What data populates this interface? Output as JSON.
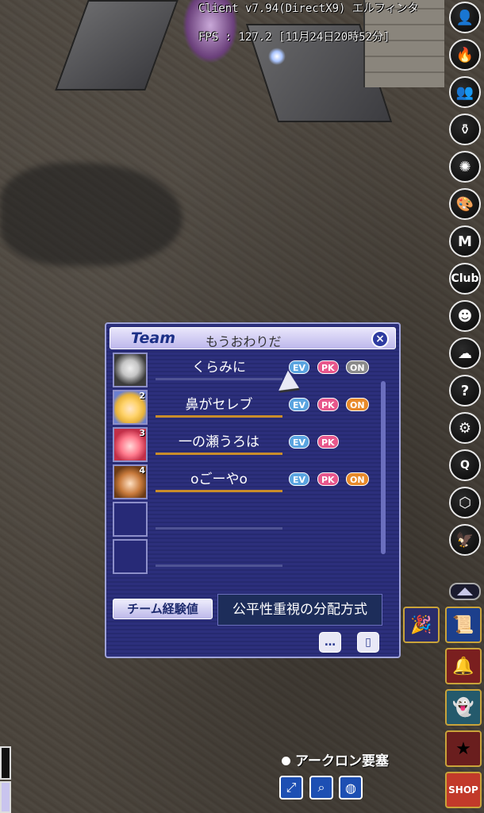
{
  "system": {
    "client_line": "Client v7.94(DirectX9) エルフィンタ",
    "fps_line": "FPS : 127.2 [11月24日20時52分]"
  },
  "team": {
    "header_label": "Team",
    "team_name": "もうおわりだ",
    "close_icon": "×",
    "members": [
      {
        "name": "くらみに",
        "number": "",
        "tags": [
          "EV",
          "PK",
          "ON"
        ]
      },
      {
        "name": "鼻がセレブ",
        "number": "2",
        "tags": [
          "EV",
          "PK",
          "ON"
        ]
      },
      {
        "name": "一の瀬うろは",
        "number": "3",
        "tags": [
          "EV",
          "PK"
        ]
      },
      {
        "name": "oごーやo",
        "number": "4",
        "tags": [
          "EV",
          "PK",
          "ON"
        ]
      }
    ],
    "exp_button": "チーム経験値",
    "distribution_mode": "公平性重視の分配方式",
    "chat_icon": "…",
    "exit_icon": "▯"
  },
  "toolbar": {
    "icons": [
      "person-icon",
      "fire-c-icon",
      "party-icon",
      "bottle-icon",
      "skill-icon",
      "palette-icon",
      "guild-icon",
      "club-icon",
      "friend-icon",
      "ghost-icon",
      "quest-icon",
      "gear-icon",
      "q-icon",
      "hexagon-icon",
      "eagle-icon"
    ],
    "club_label": "Club",
    "q_label": "Q"
  },
  "location": {
    "name": "アークロン要塞"
  },
  "colors": {
    "window_bg": "#2c2f7c",
    "tag_ev": "#5aa4e0",
    "tag_pk": "#e8578c",
    "tag_on": "#e88a2a"
  }
}
